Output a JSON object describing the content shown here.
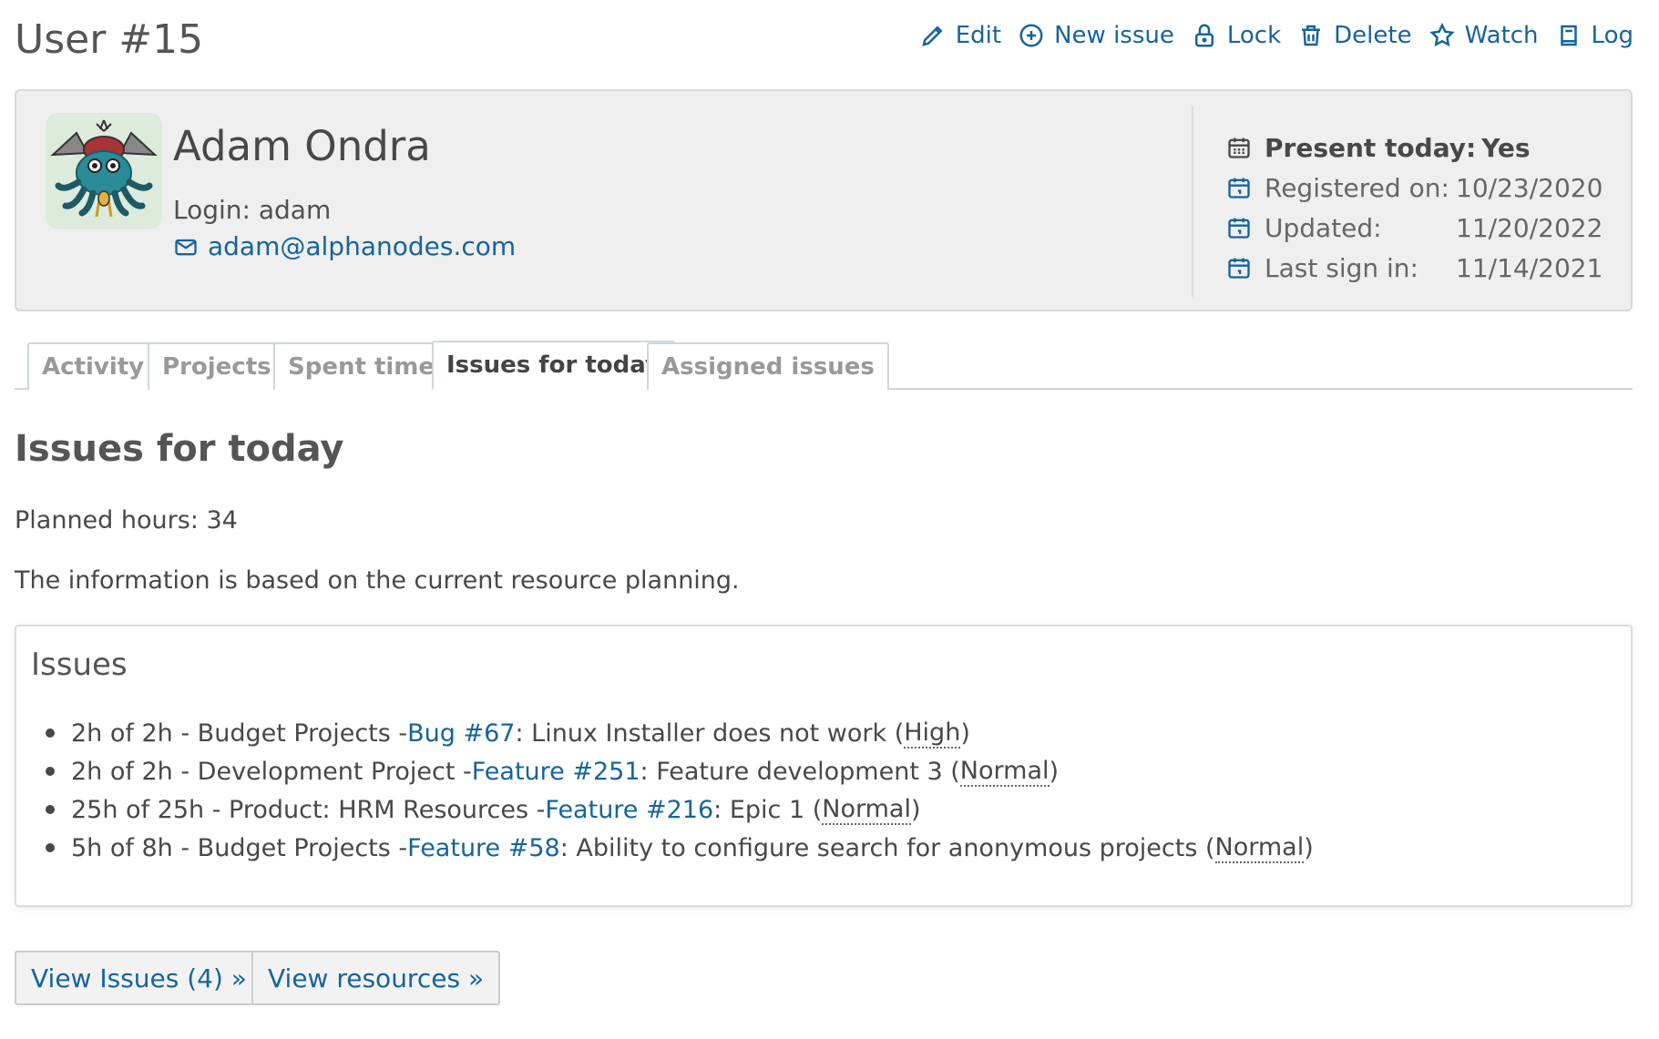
{
  "page": {
    "title": "User #15"
  },
  "contextual": {
    "edit": "Edit",
    "new_issue": "New issue",
    "lock": "Lock",
    "delete": "Delete",
    "watch": "Watch",
    "log": "Log"
  },
  "user": {
    "name": "Adam Ondra",
    "login": "Login: adam",
    "email": "adam@alphanodes.com"
  },
  "info": {
    "present_label": "Present today:",
    "present_value": "Yes",
    "registered_label": "Registered on:",
    "registered_value": "10/23/2020",
    "updated_label": "Updated:",
    "updated_value": "11/20/2022",
    "last_sign_label": "Last sign in:",
    "last_sign_value": "11/14/2021"
  },
  "tabs": [
    {
      "label": "Activity"
    },
    {
      "label": "Projects"
    },
    {
      "label": "Spent time"
    },
    {
      "label": "Issues for today"
    },
    {
      "label": "Assigned issues"
    }
  ],
  "content": {
    "title": "Issues for today",
    "planned": "Planned hours: 34",
    "based": "The information is based on the current resource planning."
  },
  "issues": {
    "title": "Issues",
    "items": [
      {
        "prefix": "2h of 2h - Budget Projects - ",
        "link": "Bug #67",
        "subject": ": Linux Installer does not work (",
        "priority": "High",
        "suffix": ")"
      },
      {
        "prefix": "2h of 2h - Development Project - ",
        "link": "Feature #251",
        "subject": ": Feature development 3 (",
        "priority": "Normal",
        "suffix": ")"
      },
      {
        "prefix": "25h of 25h - Product: HRM Resources - ",
        "link": "Feature #216",
        "subject": ": Epic 1 (",
        "priority": "Normal",
        "suffix": ")"
      },
      {
        "prefix": "5h of 8h - Budget Projects - ",
        "link": "Feature #58",
        "subject": ": Ability to configure search for anonymous projects (",
        "priority": "Normal",
        "suffix": ")"
      }
    ]
  },
  "buttons": {
    "view_issues": "View Issues (4) »",
    "view_resources": "View resources »"
  }
}
